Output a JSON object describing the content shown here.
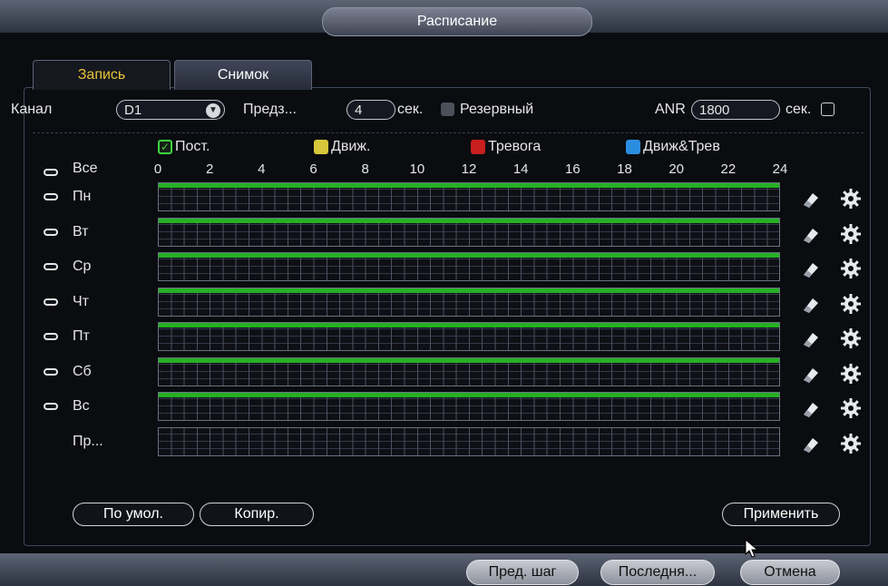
{
  "window": {
    "title": "Расписание"
  },
  "tabs": [
    {
      "label": "Запись",
      "active": true
    },
    {
      "label": "Снимок",
      "active": false
    }
  ],
  "settings": {
    "channel_label": "Канал",
    "channel_value": "D1",
    "pre_label": "Предз...",
    "pre_value": "4",
    "pre_unit": "сек.",
    "redundancy_label": "Резервный",
    "redundancy_checked": false,
    "anr_label": "ANR",
    "anr_value": "1800",
    "anr_unit": "сек.",
    "anr_checked": false
  },
  "legend": [
    {
      "label": "Пост.",
      "color": "#3fd23f",
      "checked": true
    },
    {
      "label": "Движ.",
      "color": "#d8c73b",
      "checked": false
    },
    {
      "label": "Тревога",
      "color": "#c81e1e",
      "checked": false
    },
    {
      "label": "Движ&Трев",
      "color": "#2b8de0",
      "checked": false
    }
  ],
  "all_label": "Все",
  "hours": [
    "0",
    "2",
    "4",
    "6",
    "8",
    "10",
    "12",
    "14",
    "16",
    "18",
    "20",
    "22",
    "24"
  ],
  "days": [
    {
      "label": "Пн",
      "recording": true
    },
    {
      "label": "Вт",
      "recording": true
    },
    {
      "label": "Ср",
      "recording": true
    },
    {
      "label": "Чт",
      "recording": true
    },
    {
      "label": "Пт",
      "recording": true
    },
    {
      "label": "Сб",
      "recording": true
    },
    {
      "label": "Вс",
      "recording": true
    },
    {
      "label": "Пр...",
      "recording": false
    }
  ],
  "buttons": {
    "default": "По умол.",
    "copy": "Копир.",
    "apply": "Применить"
  },
  "footer": {
    "prev": "Пред. шаг",
    "last": "Последня...",
    "cancel": "Отмена"
  },
  "colors": {
    "accent_tab": "#e7c235",
    "record_bar": "#26b024"
  }
}
